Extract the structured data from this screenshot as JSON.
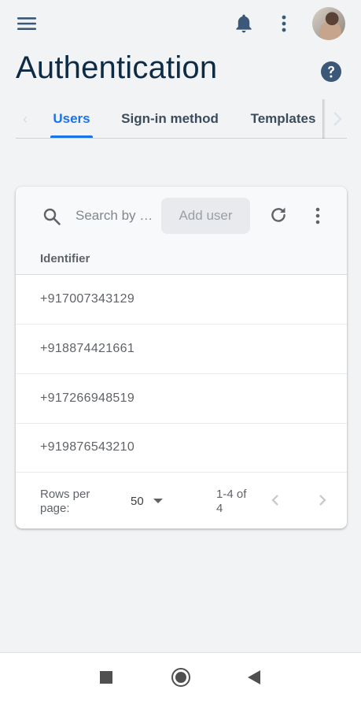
{
  "header": {
    "title": "Authentication",
    "icons": [
      "menu-icon",
      "bell-icon",
      "more-vert-icon",
      "avatar",
      "help-icon"
    ]
  },
  "tabs": [
    {
      "label": "Users",
      "active": true
    },
    {
      "label": "Sign-in method",
      "active": false
    },
    {
      "label": "Templates",
      "active": false
    }
  ],
  "users_card": {
    "search_placeholder": "Search by …",
    "add_user_label": "Add user",
    "column_header": "Identifier",
    "rows": [
      {
        "identifier": "+917007343129"
      },
      {
        "identifier": "+918874421661"
      },
      {
        "identifier": "+917266948519"
      },
      {
        "identifier": "+919876543210"
      }
    ],
    "pagination": {
      "rows_per_page_label": "Rows per page:",
      "rows_per_page_value": "50",
      "range_text": "1-4 of 4"
    }
  },
  "colors": {
    "accent": "#1a73e8",
    "title": "#0d2b45",
    "icon": "#3c5878",
    "background": "#f1f3f4"
  }
}
